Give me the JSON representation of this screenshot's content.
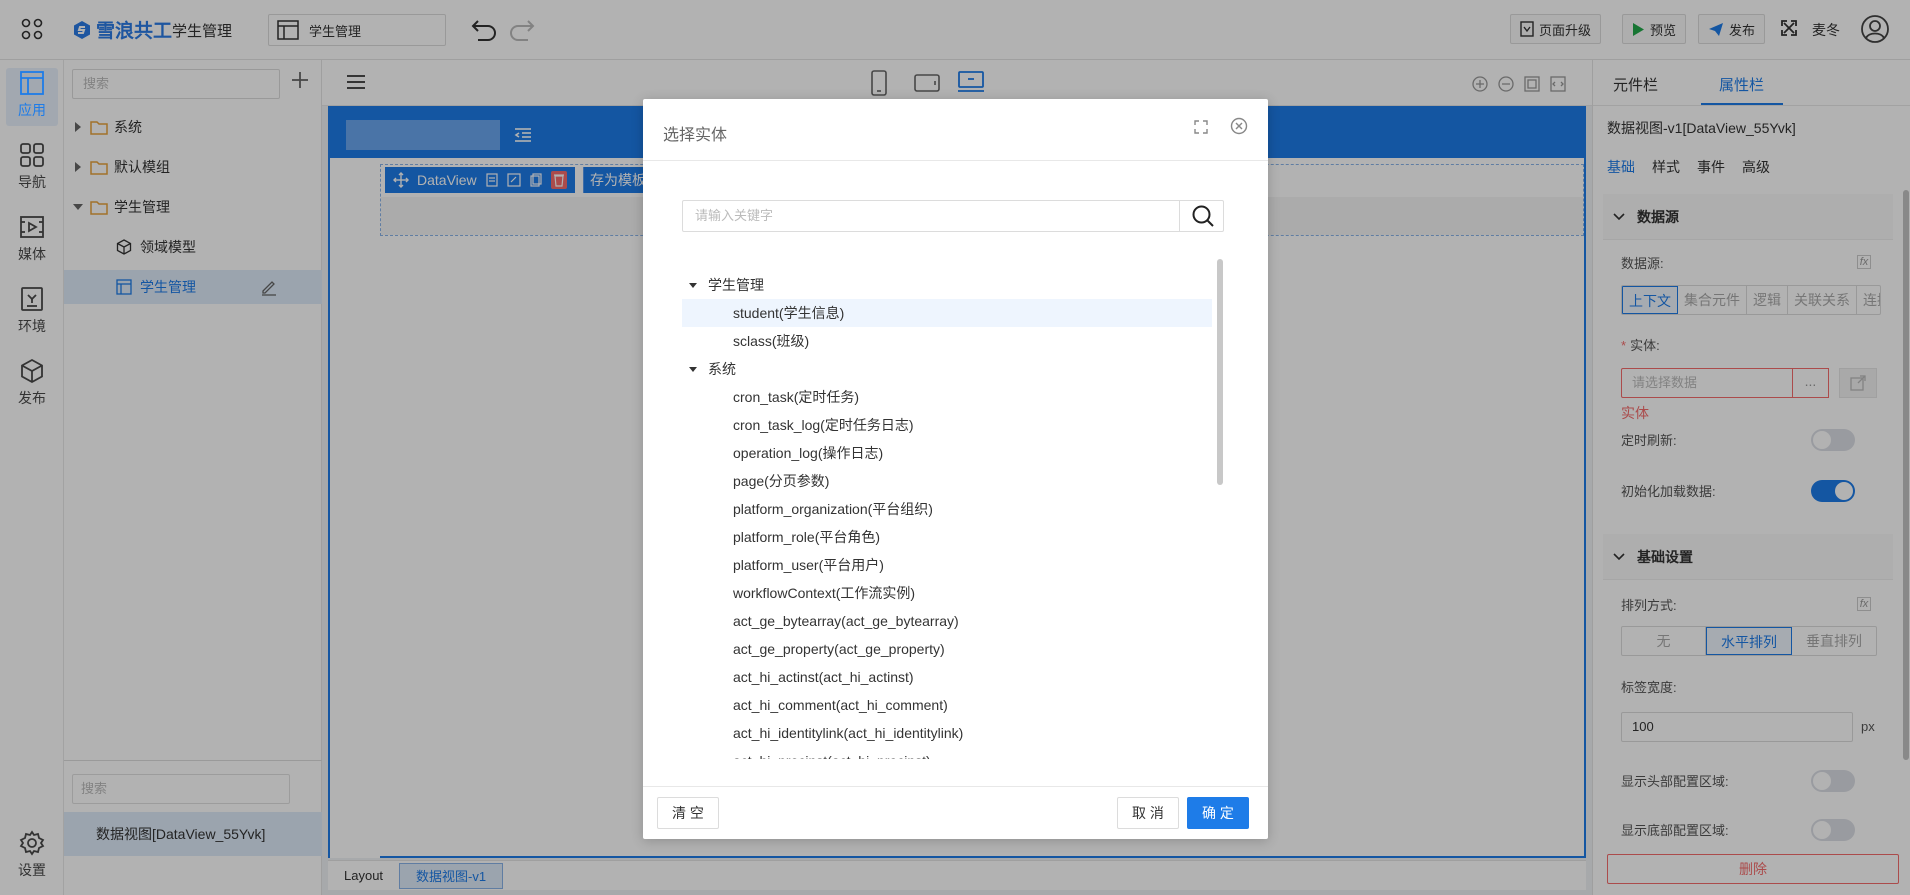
{
  "topbar": {
    "logo_text": "雪浪共工",
    "app_name": "学生管理",
    "page_select": "学生管理",
    "upgrade_label": "页面升级",
    "preview_label": "预览",
    "publish_label": "发布",
    "user_name": "麦冬",
    "brand_color": "#1e7ce8"
  },
  "leftnav": {
    "items": [
      {
        "label": "应用",
        "icon": "app-layout-icon",
        "active": true
      },
      {
        "label": "导航",
        "icon": "grid-icon"
      },
      {
        "label": "媒体",
        "icon": "media-icon"
      },
      {
        "label": "环境",
        "icon": "environment-icon"
      },
      {
        "label": "发布",
        "icon": "cube-icon"
      }
    ],
    "settings_label": "设置"
  },
  "tree_panel": {
    "search_placeholder": "搜索",
    "items": [
      {
        "label": "系统"
      },
      {
        "label": "默认模组"
      },
      {
        "label": "学生管理"
      },
      {
        "label": "领域模型"
      },
      {
        "label": "学生管理"
      }
    ],
    "bottom_search_placeholder": "搜索",
    "selected_component": "数据视图[DataView_55Yvk]"
  },
  "canvas": {
    "dataview_label": "DataView",
    "save_label": "存为模板",
    "breadcrumb": [
      "Layout",
      "数据视图-v1"
    ]
  },
  "right_panel": {
    "tabs": [
      "元件栏",
      "属性栏"
    ],
    "title": "数据视图-v1[DataView_55Yvk]",
    "subtabs": [
      "基础",
      "样式",
      "事件",
      "高级"
    ],
    "datasource_section": "数据源",
    "datasource_label": "数据源:",
    "datasource_options": [
      "上下文",
      "集合元件",
      "逻辑",
      "关联关系",
      "连接"
    ],
    "entity_label": "实体:",
    "entity_placeholder": "请选择数据",
    "entity_btn": "...",
    "entity_error": "实体",
    "timer_refresh_label": "定时刷新:",
    "timer_refresh_on": false,
    "init_load_label": "初始化加载数据:",
    "init_load_on": true,
    "basic_section": "基础设置",
    "arrange_label": "排列方式:",
    "arrange_options": [
      "无",
      "水平排列",
      "垂直排列"
    ],
    "label_width_label": "标签宽度:",
    "label_width_value": "100",
    "label_width_unit": "px",
    "show_header_label": "显示头部配置区域:",
    "show_footer_label": "显示底部配置区域:",
    "delete_label": "删除",
    "fx_label": "fx"
  },
  "modal": {
    "title": "选择实体",
    "search_placeholder": "请输入关键字",
    "groups": [
      {
        "label": "学生管理",
        "items": [
          "student(学生信息)",
          "sclass(班级)"
        ]
      },
      {
        "label": "系统",
        "items": [
          "cron_task(定时任务)",
          "cron_task_log(定时任务日志)",
          "operation_log(操作日志)",
          "page(分页参数)",
          "platform_organization(平台组织)",
          "platform_role(平台角色)",
          "platform_user(平台用户)",
          "workflowContext(工作流实例)",
          "act_ge_bytearray(act_ge_bytearray)",
          "act_ge_property(act_ge_property)",
          "act_hi_actinst(act_hi_actinst)",
          "act_hi_comment(act_hi_comment)",
          "act_hi_identitylink(act_hi_identitylink)",
          "act_hi_procinst(act_hi_procinst)"
        ]
      }
    ],
    "clear_label": "清 空",
    "cancel_label": "取 消",
    "confirm_label": "确 定"
  }
}
